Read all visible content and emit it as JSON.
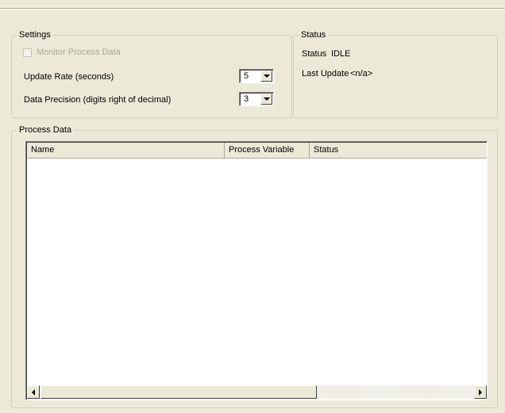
{
  "settings": {
    "title": "Settings",
    "monitor_label": "Monitor Process Data",
    "monitor_checked": false,
    "update_rate_label": "Update Rate (seconds)",
    "update_rate_value": "5",
    "precision_label": "Data Precision (digits right of decimal)",
    "precision_value": "3"
  },
  "status": {
    "title": "Status",
    "status_label": "Status",
    "status_value": "IDLE",
    "last_update_label": "Last Update",
    "last_update_value": "<n/a>"
  },
  "process_data": {
    "title": "Process Data",
    "columns": [
      "Name",
      "Process Variable",
      "Status"
    ],
    "rows": []
  },
  "colors": {
    "background": "#ece9d8",
    "disabled_text": "#aca899",
    "list_background": "#ffffff"
  }
}
